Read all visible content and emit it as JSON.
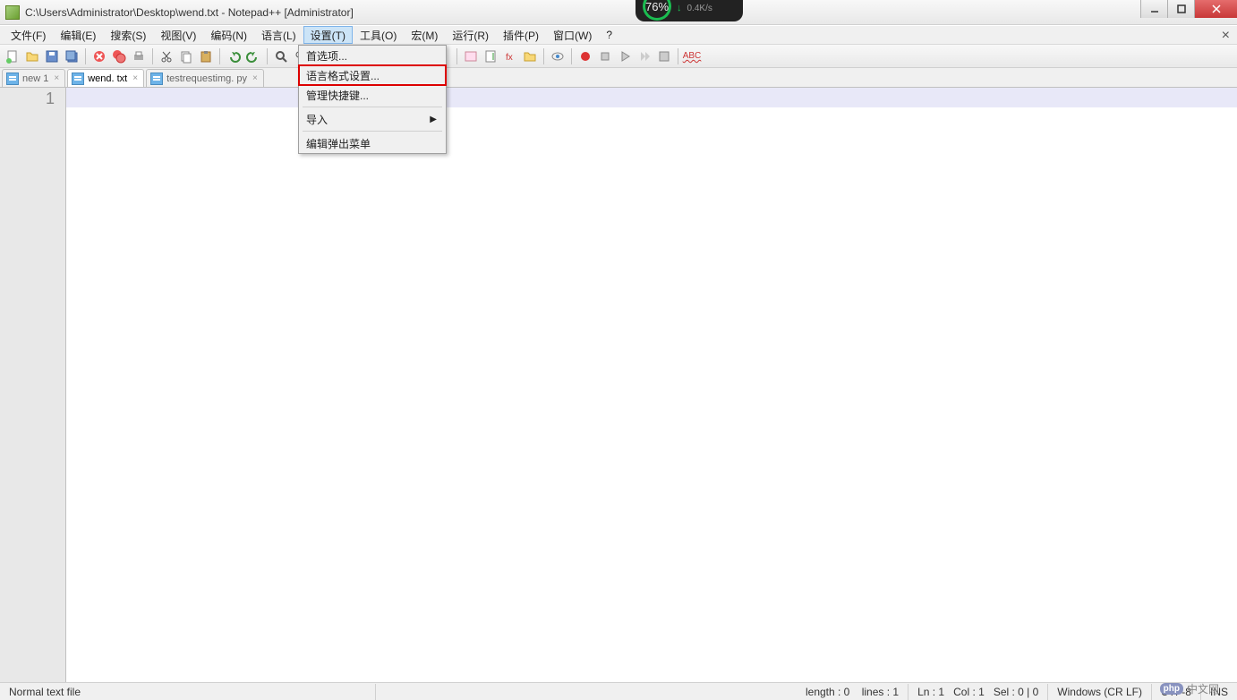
{
  "title": "C:\\Users\\Administrator\\Desktop\\wend.txt - Notepad++ [Administrator]",
  "overlay": {
    "percent": "76%",
    "speed": "0.4K/s"
  },
  "menubar": {
    "items": [
      "文件(F)",
      "编辑(E)",
      "搜索(S)",
      "视图(V)",
      "编码(N)",
      "语言(L)",
      "设置(T)",
      "工具(O)",
      "宏(M)",
      "运行(R)",
      "插件(P)",
      "窗口(W)",
      "?"
    ],
    "active_index": 6
  },
  "tabs": [
    {
      "label": "new 1",
      "active": false
    },
    {
      "label": "wend. txt",
      "active": true
    },
    {
      "label": "testrequestimg. py",
      "active": false
    }
  ],
  "dropdown": {
    "items": [
      {
        "label": "首选项...",
        "type": "item"
      },
      {
        "label": "语言格式设置...",
        "type": "item",
        "highlighted": true
      },
      {
        "label": "管理快捷键...",
        "type": "item"
      },
      {
        "type": "sep"
      },
      {
        "label": "导入",
        "type": "submenu"
      },
      {
        "type": "sep"
      },
      {
        "label": "编辑弹出菜单",
        "type": "item"
      }
    ]
  },
  "editor": {
    "line_number": "1"
  },
  "status": {
    "filetype": "Normal text file",
    "length": "length : 0",
    "lines": "lines : 1",
    "ln": "Ln : 1",
    "col": "Col : 1",
    "sel": "Sel : 0 | 0",
    "eol": "Windows (CR LF)",
    "encoding": "UTF-8",
    "mode": "INS"
  },
  "watermark": "中文网"
}
